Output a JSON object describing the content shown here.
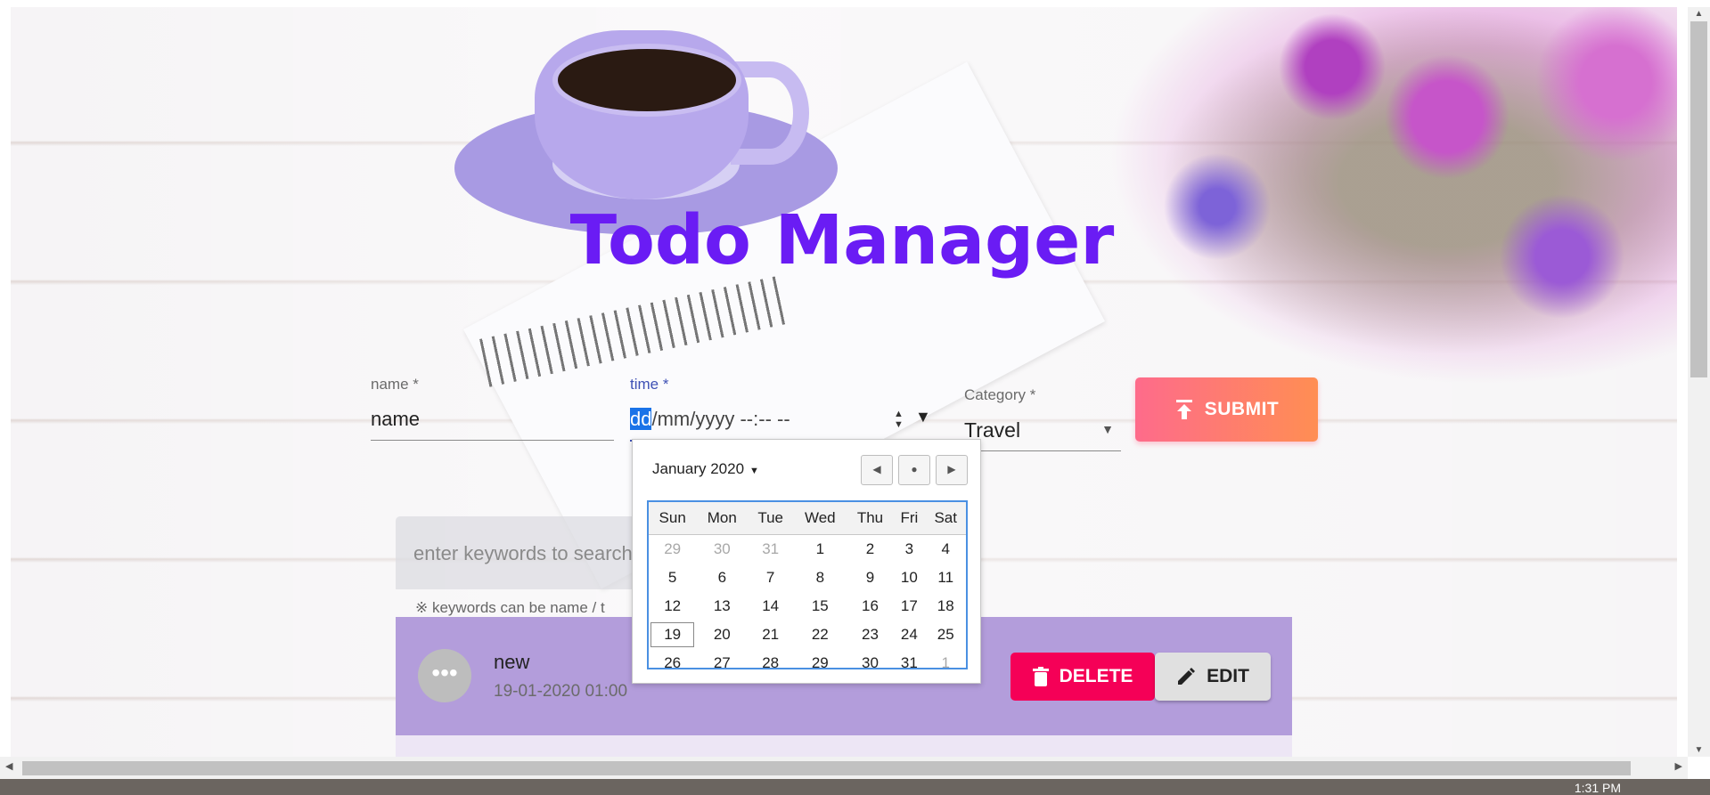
{
  "app": {
    "title": "Todo Manager"
  },
  "form": {
    "name_label": "name *",
    "name_value": "name",
    "time_label": "time *",
    "time_value_highlight": "dd",
    "time_value_rest": "/mm/yyyy --:-- --",
    "category_label": "Category *",
    "category_value": "Travel",
    "submit_label": "SUBMIT"
  },
  "search": {
    "placeholder": "enter keywords to search",
    "hint": "※ keywords can be name / t"
  },
  "calendar": {
    "month_label": "January 2020",
    "weekdays": [
      "Sun",
      "Mon",
      "Tue",
      "Wed",
      "Thu",
      "Fri",
      "Sat"
    ],
    "weeks": [
      [
        "29",
        "30",
        "31",
        "1",
        "2",
        "3",
        "4"
      ],
      [
        "5",
        "6",
        "7",
        "8",
        "9",
        "10",
        "11"
      ],
      [
        "12",
        "13",
        "14",
        "15",
        "16",
        "17",
        "18"
      ],
      [
        "19",
        "20",
        "21",
        "22",
        "23",
        "24",
        "25"
      ],
      [
        "26",
        "27",
        "28",
        "29",
        "30",
        "31",
        "1"
      ]
    ]
  },
  "todos": [
    {
      "name": "new",
      "date": "19-01-2020 01:00",
      "delete_label": "DELETE",
      "edit_label": "EDIT"
    }
  ],
  "taskbar": {
    "clock": "1:31 PM"
  },
  "colors": {
    "title": "#6a1cf4",
    "todo_bg": "#b39ddb",
    "delete": "#f50057",
    "submit_from": "#fe6b8b",
    "submit_to": "#ff8e53"
  }
}
